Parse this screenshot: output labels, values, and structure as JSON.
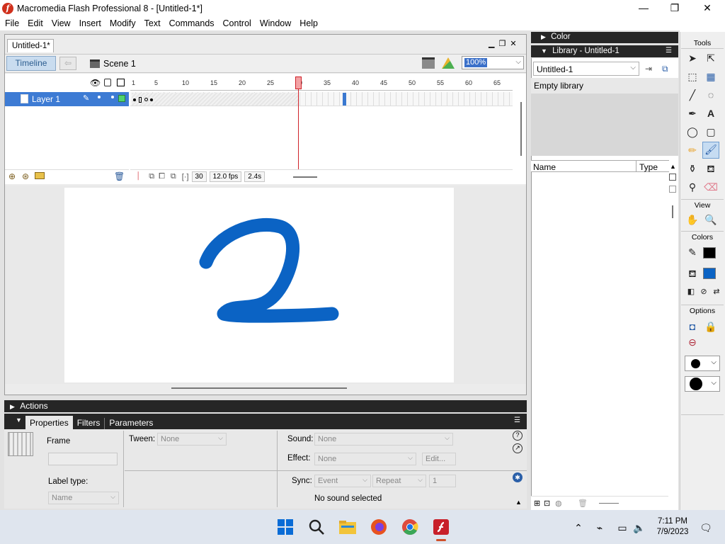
{
  "window": {
    "title": "Macromedia Flash Professional 8 - [Untitled-1*]",
    "app_icon": "f",
    "controls": [
      "—",
      "❐",
      "✕"
    ]
  },
  "menu": [
    "File",
    "Edit",
    "View",
    "Insert",
    "Modify",
    "Text",
    "Commands",
    "Control",
    "Window",
    "Help"
  ],
  "document": {
    "tab": "Untitled-1*",
    "timeline_button": "Timeline",
    "scene": "Scene 1",
    "zoom": "100%"
  },
  "timeline": {
    "layer_name": "Layer 1",
    "ruler_ticks": [
      "1",
      "5",
      "10",
      "15",
      "20",
      "25",
      "30",
      "35",
      "40",
      "45",
      "50",
      "55",
      "60",
      "65"
    ],
    "current_frame": "30",
    "frame_rate": "12.0 fps",
    "elapsed": "2.4s"
  },
  "stage": {
    "drawing": "2",
    "stroke_color": "#0b63c4"
  },
  "panels": {
    "actions": "Actions",
    "tabs": [
      "Properties",
      "Filters",
      "Parameters"
    ]
  },
  "properties": {
    "frame_label": "Frame",
    "tween_label": "Tween:",
    "tween_value": "None",
    "sound_label": "Sound:",
    "sound_value": "None",
    "effect_label": "Effect:",
    "effect_value": "None",
    "edit_button": "Edit...",
    "sync_label": "Sync:",
    "sync_value": "Event",
    "repeat_value": "Repeat",
    "repeat_count": "1",
    "label_type_label": "Label type:",
    "label_type_value": "Name",
    "sound_status": "No sound selected"
  },
  "right_panels": {
    "color_title": "Color",
    "library_title": "Library - Untitled-1",
    "library_select": "Untitled-1",
    "empty_library": "Empty library",
    "col_name": "Name",
    "col_type": "Type"
  },
  "tools": {
    "header": "Tools",
    "view_header": "View",
    "colors_header": "Colors",
    "options_header": "Options",
    "text_tool": "A",
    "fill_color": "#0b63c4",
    "stroke_color": "#000000"
  },
  "taskbar": {
    "time": "7:11 PM",
    "date": "7/9/2023"
  }
}
